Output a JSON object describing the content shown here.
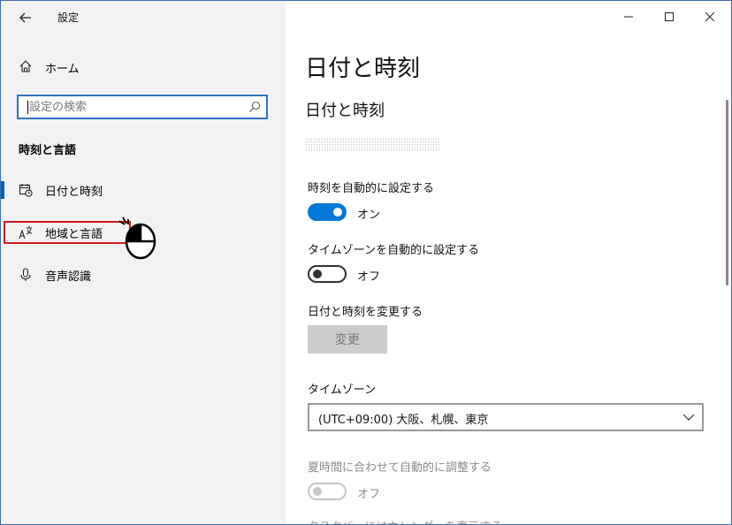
{
  "window": {
    "title": "設定"
  },
  "sidebar": {
    "home_label": "ホーム",
    "search_placeholder": "設定の検索",
    "section_heading": "時刻と言語",
    "items": [
      {
        "label": "日付と時刻",
        "icon": "calendar-clock-icon",
        "active": true
      },
      {
        "label": "地域と言語",
        "icon": "language-icon",
        "active": false
      },
      {
        "label": "音声認識",
        "icon": "microphone-icon",
        "active": false
      }
    ]
  },
  "main": {
    "page_title": "日付と時刻",
    "section_title": "日付と時刻",
    "auto_time": {
      "label": "時刻を自動的に設定する",
      "state": "オン",
      "on": true
    },
    "auto_timezone": {
      "label": "タイムゾーンを自動的に設定する",
      "state": "オフ",
      "on": false
    },
    "change_datetime": {
      "label": "日付と時刻を変更する",
      "button": "変更"
    },
    "timezone": {
      "label": "タイムゾーン",
      "value": "(UTC+09:00) 大阪、札幌、東京"
    },
    "dst": {
      "label": "夏時間に合わせて自動的に調整する",
      "state": "オフ",
      "enabled": false
    },
    "cut_off_text": "タスクバーにはカレンダーを表示する"
  },
  "colors": {
    "accent": "#0078d7",
    "highlight": "#d21c1c",
    "sidebar_bg": "#f2f2f2"
  }
}
